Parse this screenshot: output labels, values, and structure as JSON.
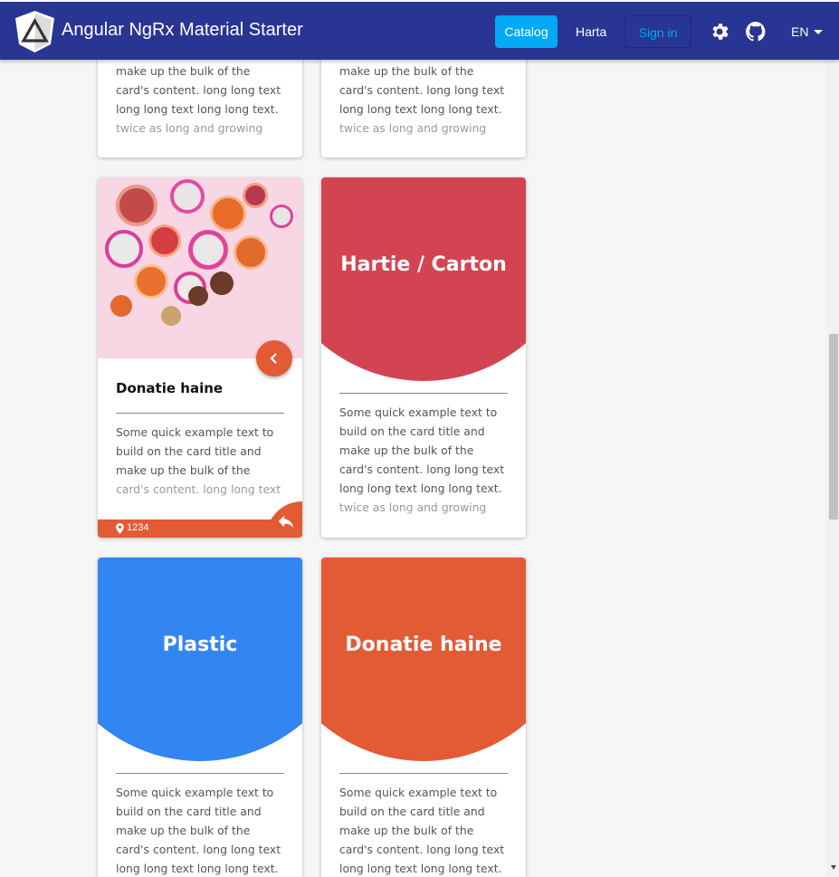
{
  "toolbar": {
    "title": "Angular NgRx Material Starter",
    "nav": {
      "catalog": "Catalog",
      "harta": "Harta",
      "signin": "Sign in"
    },
    "language": "EN",
    "icons": {
      "logo": "angular-logo-icon",
      "settings": "gear-icon",
      "github": "github-icon",
      "caret": "caret-down-icon"
    }
  },
  "cards": {
    "top_left": {
      "text_lines": [
        "make up the bulk of the",
        "card's content. long long text",
        "long long text long long text.",
        "twice as long and growing"
      ]
    },
    "top_right": {
      "text_lines": [
        "make up the bulk of the",
        "card's content. long long text",
        "long long text long long text.",
        "twice as long and growing"
      ]
    },
    "photo_card": {
      "title": "Donatie haine",
      "text_lines": [
        "Some quick example text to",
        "build on the card title and",
        "make up the bulk of the",
        "card's content. long long text"
      ],
      "footer_count": "1234",
      "icons": {
        "fab": "chevron-left-icon",
        "location": "location-pin-icon",
        "reply": "reply-icon"
      }
    },
    "hartie": {
      "title": "Hartie / Carton",
      "color": "#d34452",
      "text_lines": [
        "Some quick example text to",
        "build on the card title and",
        "make up the bulk of the",
        "card's content. long long text",
        "long long text long long text.",
        "twice as long and growing"
      ]
    },
    "plastic": {
      "title": "Plastic",
      "color": "#3386f1",
      "text_lines": [
        "Some quick example text to",
        "build on the card title and",
        "make up the bulk of the",
        "card's content. long long text",
        "long long text long long text."
      ]
    },
    "haine": {
      "title": "Donatie haine",
      "color": "#e25b35",
      "text_lines": [
        "Some quick example text to",
        "build on the card title and",
        "make up the bulk of the",
        "card's content. long long text",
        "long long text long long text."
      ]
    }
  }
}
